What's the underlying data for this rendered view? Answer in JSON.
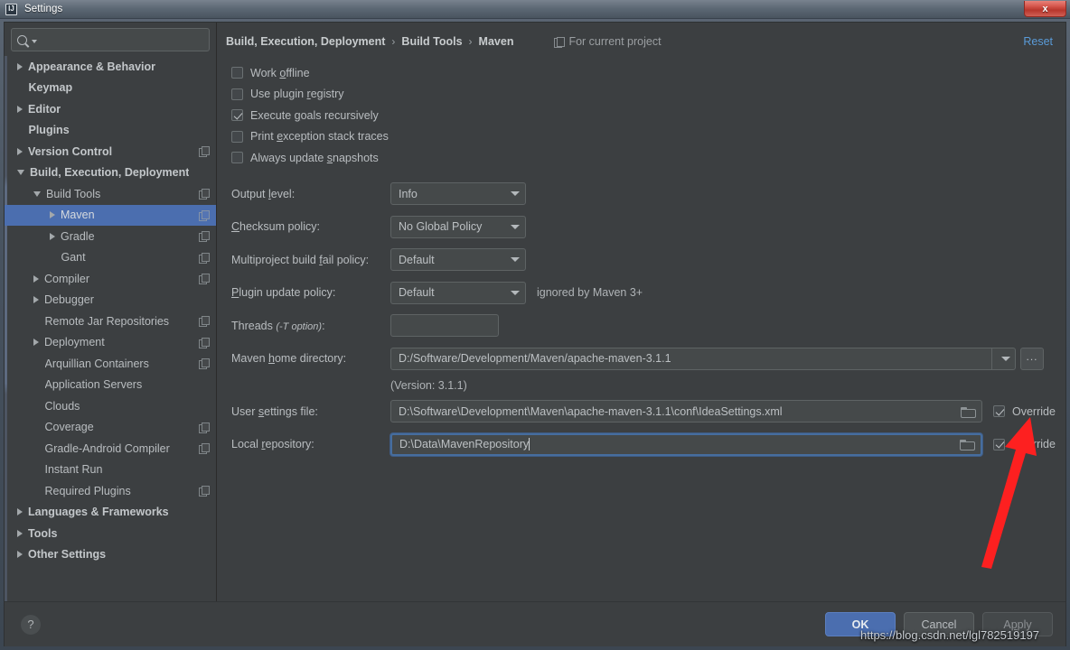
{
  "window": {
    "title": "Settings",
    "app_icon": "intellij-idea-icon",
    "close_label": "x"
  },
  "sidebar": {
    "search": {
      "placeholder": "",
      "value": "",
      "icon": "search-icon"
    },
    "items": [
      {
        "label": "Appearance & Behavior",
        "indent": 0,
        "twisty": "closed",
        "bold": true,
        "copy": false,
        "selected": false
      },
      {
        "label": "Keymap",
        "indent": 0,
        "twisty": "none",
        "bold": true,
        "copy": false,
        "selected": false
      },
      {
        "label": "Editor",
        "indent": 0,
        "twisty": "closed",
        "bold": true,
        "copy": false,
        "selected": false
      },
      {
        "label": "Plugins",
        "indent": 0,
        "twisty": "none",
        "bold": true,
        "copy": false,
        "selected": false
      },
      {
        "label": "Version Control",
        "indent": 0,
        "twisty": "closed",
        "bold": true,
        "copy": true,
        "selected": false
      },
      {
        "label": "Build, Execution, Deployment",
        "indent": 0,
        "twisty": "open",
        "bold": true,
        "copy": false,
        "selected": false
      },
      {
        "label": "Build Tools",
        "indent": 1,
        "twisty": "open",
        "bold": false,
        "copy": true,
        "selected": false
      },
      {
        "label": "Maven",
        "indent": 2,
        "twisty": "closed",
        "bold": false,
        "copy": true,
        "selected": true
      },
      {
        "label": "Gradle",
        "indent": 2,
        "twisty": "closed",
        "bold": false,
        "copy": true,
        "selected": false
      },
      {
        "label": "Gant",
        "indent": 2,
        "twisty": "none",
        "bold": false,
        "copy": true,
        "selected": false
      },
      {
        "label": "Compiler",
        "indent": 1,
        "twisty": "closed",
        "bold": false,
        "copy": true,
        "selected": false
      },
      {
        "label": "Debugger",
        "indent": 1,
        "twisty": "closed",
        "bold": false,
        "copy": false,
        "selected": false
      },
      {
        "label": "Remote Jar Repositories",
        "indent": 1,
        "twisty": "none",
        "bold": false,
        "copy": true,
        "selected": false
      },
      {
        "label": "Deployment",
        "indent": 1,
        "twisty": "closed",
        "bold": false,
        "copy": true,
        "selected": false
      },
      {
        "label": "Arquillian Containers",
        "indent": 1,
        "twisty": "none",
        "bold": false,
        "copy": true,
        "selected": false
      },
      {
        "label": "Application Servers",
        "indent": 1,
        "twisty": "none",
        "bold": false,
        "copy": false,
        "selected": false
      },
      {
        "label": "Clouds",
        "indent": 1,
        "twisty": "none",
        "bold": false,
        "copy": false,
        "selected": false
      },
      {
        "label": "Coverage",
        "indent": 1,
        "twisty": "none",
        "bold": false,
        "copy": true,
        "selected": false
      },
      {
        "label": "Gradle-Android Compiler",
        "indent": 1,
        "twisty": "none",
        "bold": false,
        "copy": true,
        "selected": false
      },
      {
        "label": "Instant Run",
        "indent": 1,
        "twisty": "none",
        "bold": false,
        "copy": false,
        "selected": false
      },
      {
        "label": "Required Plugins",
        "indent": 1,
        "twisty": "none",
        "bold": false,
        "copy": true,
        "selected": false
      },
      {
        "label": "Languages & Frameworks",
        "indent": 0,
        "twisty": "closed",
        "bold": true,
        "copy": false,
        "selected": false
      },
      {
        "label": "Tools",
        "indent": 0,
        "twisty": "closed",
        "bold": true,
        "copy": false,
        "selected": false
      },
      {
        "label": "Other Settings",
        "indent": 0,
        "twisty": "closed",
        "bold": true,
        "copy": false,
        "selected": false
      }
    ]
  },
  "header": {
    "breadcrumb": [
      "Build, Execution, Deployment",
      "Build Tools",
      "Maven"
    ],
    "separator": "›",
    "scope_text": "For current project",
    "scope_icon": "project-scope-icon",
    "reset_label": "Reset",
    "reset_color": "#5a9bd8"
  },
  "form": {
    "checkboxes": [
      {
        "pre": "Work ",
        "mn": "o",
        "post": "ffline",
        "checked": false
      },
      {
        "pre": "Use plugin ",
        "mn": "r",
        "post": "egistry",
        "checked": false
      },
      {
        "pre": "Execute ",
        "mn": "g",
        "post": "oals recursively",
        "checked": true
      },
      {
        "pre": "Print ",
        "mn": "e",
        "post": "xception stack traces",
        "checked": false
      },
      {
        "pre": "Always update ",
        "mn": "s",
        "post": "napshots",
        "checked": false
      }
    ],
    "combos": [
      {
        "pre": "Output ",
        "mn": "l",
        "post": "evel:",
        "value": "Info",
        "hint": ""
      },
      {
        "pre": "",
        "mn": "C",
        "post": "hecksum policy:",
        "value": "No Global Policy",
        "hint": ""
      },
      {
        "pre": "Multiproject build ",
        "mn": "f",
        "post": "ail policy:",
        "value": "Default",
        "hint": ""
      },
      {
        "pre": "",
        "mn": "P",
        "post": "lugin update policy:",
        "value": "Default",
        "hint": "ignored by Maven 3+"
      }
    ],
    "threads": {
      "label_main": "Threads ",
      "label_italic": "(-T option)",
      "label_tail": ":",
      "value": "",
      "placeholder": ""
    },
    "maven_home": {
      "pre": "Maven ",
      "mn": "h",
      "post": "ome directory:",
      "value": "D:/Software/Development/Maven/apache-maven-3.1.1",
      "browse_label": "...",
      "version_note": "(Version: 3.1.1)"
    },
    "user_settings": {
      "pre": "User ",
      "mn": "s",
      "post": "ettings file:",
      "value": "D:\\Software\\Development\\Maven\\apache-maven-3.1.1\\conf\\IdeaSettings.xml",
      "override_label": "Override",
      "override_checked": true,
      "folder_icon": "folder-browse-icon"
    },
    "local_repo": {
      "pre": "Local ",
      "mn": "r",
      "post": "epository:",
      "value": "D:\\Data\\MavenRepository",
      "override_label": "Override",
      "override_checked": true,
      "folder_icon": "folder-browse-icon",
      "focused": true
    }
  },
  "footer": {
    "help_label": "?",
    "ok_label": "OK",
    "cancel_label": "Cancel",
    "apply_pre": "A",
    "apply_mn": "p",
    "apply_post": "ply",
    "ok_color": "#4b6eaf"
  },
  "annotation": {
    "watermark": "https://blog.csdn.net/lgl782519197",
    "arrow_color": "#fd2020"
  }
}
